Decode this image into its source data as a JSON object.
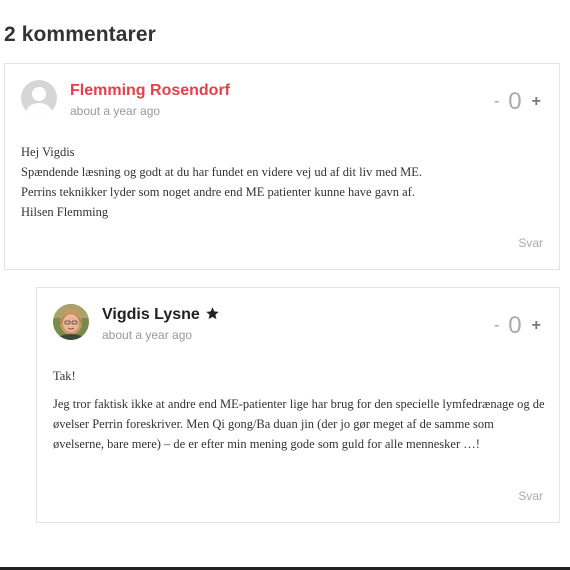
{
  "section_title": "2 kommentarer",
  "comments": [
    {
      "author": "Flemming Rosendorf",
      "time": "about a year ago",
      "vote_minus": "-",
      "vote_count": "0",
      "vote_plus": "+",
      "paragraphs": [
        "Hej Vigdis",
        "Spændende læsning og godt at du har fundet en videre vej ud af dit liv med ME.",
        "Perrins teknikker lyder som noget andre end ME patienter kunne have gavn af.",
        "Hilsen Flemming"
      ],
      "reply_label": "Svar"
    },
    {
      "author": "Vigdis Lysne",
      "time": "about a year ago",
      "vote_minus": "-",
      "vote_count": "0",
      "vote_plus": "+",
      "paragraphs": [
        "Tak!",
        "Jeg tror faktisk ikke at andre end ME-patienter lige har brug for den specielle lymfedrænage og de øvelser Perrin foreskriver. Men Qi gong/Ba duan jin (der jo gør meget af de samme som øvelserne, bare mere) – de er efter min mening gode som guld for alle mennesker …!"
      ],
      "reply_label": "Svar"
    }
  ],
  "colors": {
    "author_link": "#e2414a",
    "muted": "#999999",
    "border": "#e4e4e4"
  },
  "icons": {
    "default_avatar": "person-silhouette-icon",
    "author_badge": "star-icon"
  }
}
